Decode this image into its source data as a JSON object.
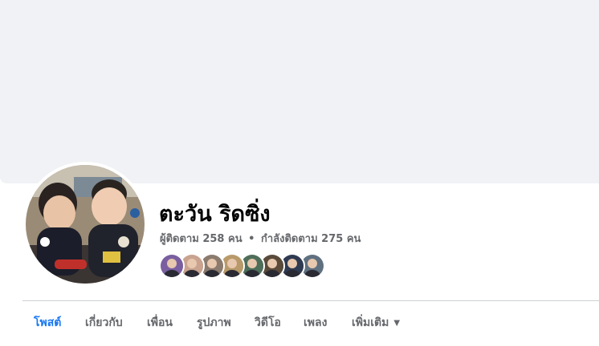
{
  "profile": {
    "name": "ตะวัน ริดซิ่ง",
    "followers_text": "ผู้ติดตาม 258 คน",
    "separator": "•",
    "following_text": "กำลังติดตาม 275 คน"
  },
  "friends": [
    {
      "name": "friend-1",
      "color": "#7a5fa0"
    },
    {
      "name": "friend-2",
      "color": "#c9a38f"
    },
    {
      "name": "friend-3",
      "color": "#8b7b6e"
    },
    {
      "name": "friend-4",
      "color": "#b89a6a"
    },
    {
      "name": "friend-5",
      "color": "#4e6e5a"
    },
    {
      "name": "friend-6",
      "color": "#5a4a3a"
    },
    {
      "name": "friend-7",
      "color": "#2f3a52"
    },
    {
      "name": "friend-8",
      "color": "#5f7080"
    }
  ],
  "tabs": [
    {
      "label": "โพสต์",
      "active": true
    },
    {
      "label": "เกี่ยวกับ"
    },
    {
      "label": "เพื่อน"
    },
    {
      "label": "รูปภาพ"
    },
    {
      "label": "วิดีโอ"
    },
    {
      "label": "เพลง"
    },
    {
      "label": "เพิ่มเติม",
      "caret": "▼"
    }
  ],
  "colors": {
    "accent": "#1877f2",
    "cover": "#f0f2f5",
    "secondary_text": "#65676b"
  }
}
